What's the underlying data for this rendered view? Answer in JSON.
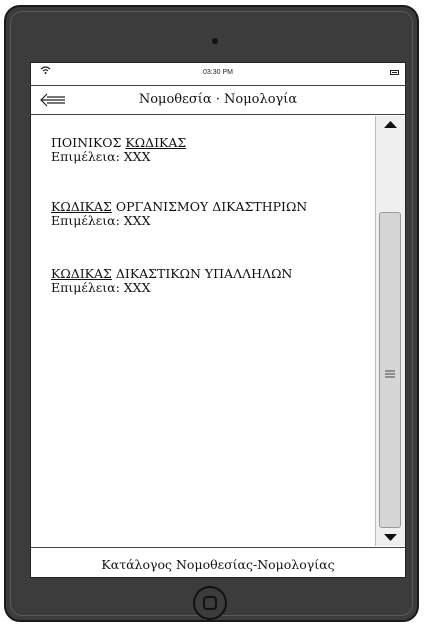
{
  "status_bar": {
    "time": "03:30 PM"
  },
  "header": {
    "title": "Νομοθεσία · Νομολογία"
  },
  "items": [
    {
      "title_plain": "ΠΟΙΝΙΚΟΣ ",
      "title_underlined": "ΚΩΔΙΚΑΣ",
      "editor": "Επιμέλεια: ΧΧΧ"
    },
    {
      "title_plain": "",
      "title_underlined": "ΚΩΔΙΚΑΣ",
      "title_rest": " ΟΡΓΑΝΙΣΜΟΥ ΔΙΚΑΣΤΗΡΙΩΝ",
      "editor": "Επιμέλεια: ΧΧΧ"
    },
    {
      "title_plain": "",
      "title_underlined": "ΚΩΔΙΚΑΣ",
      "title_rest": " ΔΙΚΑΣΤΙΚΩΝ ΥΠΑΛΛΗΛΩΝ",
      "editor": "Επιμέλεια: ΧΧΧ"
    }
  ],
  "footer": {
    "label": "Κατάλογος Νομοθεσίας-Νομολογίας"
  },
  "icons": {
    "back": "back-arrow-icon",
    "home": "home-button-icon",
    "wifi": "wifi-icon",
    "battery": "battery-icon"
  }
}
